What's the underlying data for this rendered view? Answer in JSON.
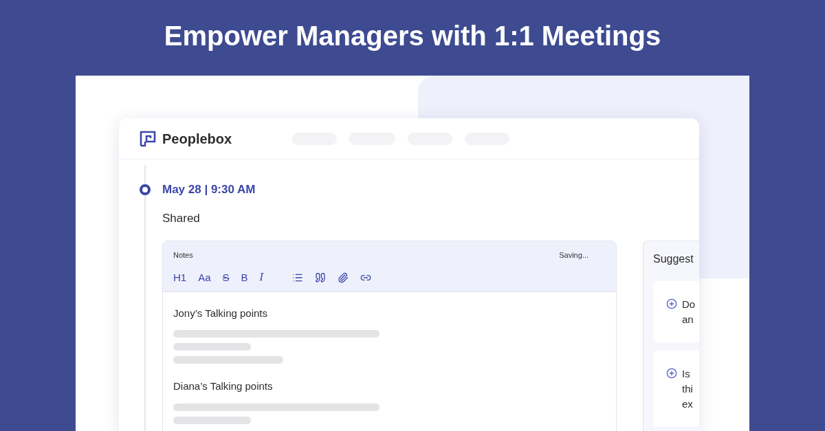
{
  "headline": "Empower Managers with 1:1 Meetings",
  "app": {
    "brand": "Peoplebox",
    "entry": {
      "date": "May 28 | 9:30 AM",
      "status": "Shared",
      "notes": {
        "label": "Notes",
        "save_status": "Saving...",
        "toolbar": [
          {
            "kind": "heading",
            "label": "H1"
          },
          {
            "kind": "size",
            "label": "Aa"
          },
          {
            "kind": "strike",
            "label": "S"
          },
          {
            "kind": "bold",
            "label": "B"
          },
          {
            "kind": "italic",
            "label": "I"
          },
          {
            "kind": "list"
          },
          {
            "kind": "quote"
          },
          {
            "kind": "attach"
          },
          {
            "kind": "link"
          }
        ],
        "sections": [
          {
            "title": "Jony’s Talking points",
            "kind": "three_lines"
          },
          {
            "title": "Diana’s Talking points",
            "kind": "two_lines"
          }
        ]
      },
      "suggestions": {
        "title": "Suggest",
        "items": [
          {
            "lines": [
              "Do",
              "an"
            ]
          },
          {
            "lines": [
              "Is",
              "thi",
              "ex"
            ]
          }
        ]
      }
    }
  }
}
